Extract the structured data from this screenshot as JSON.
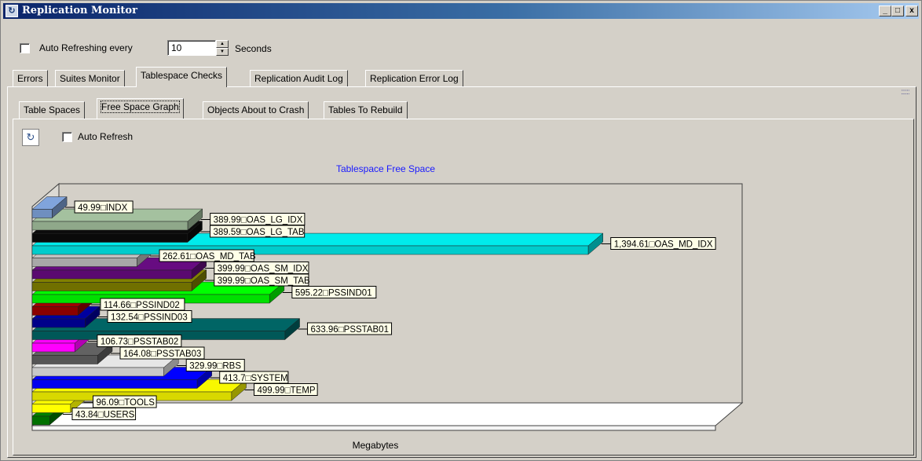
{
  "window": {
    "title": "Replication Monitor",
    "app_icon": "refresh-icon",
    "controls": [
      "_",
      "□",
      "x"
    ]
  },
  "auto_refresh_bar": {
    "checkbox_label": "Auto Refreshing every",
    "checked": false,
    "interval_value": "10",
    "unit_label": "Seconds"
  },
  "main_tabs": [
    {
      "label": "Errors"
    },
    {
      "label": "Suites Monitor"
    },
    {
      "label": "Tablespace Checks",
      "selected": true
    },
    {
      "label": "Replication Audit Log"
    },
    {
      "label": "Replication Error Log"
    }
  ],
  "sub_tabs": [
    {
      "label": "Table Spaces"
    },
    {
      "label": "Free Space Graph",
      "selected": true
    },
    {
      "label": "Objects About to Crash"
    },
    {
      "label": "Tables To Rebuild"
    }
  ],
  "graph_toolbar": {
    "refresh_icon": "refresh-icon",
    "auto_refresh_label": "Auto Refresh",
    "auto_refresh_checked": false
  },
  "chart_data": {
    "type": "bar",
    "orientation": "horizontal",
    "style": "3d",
    "title": "Tablespace  Free Space",
    "xlabel": "Megabytes",
    "ylabel": "",
    "categories": [
      "INDX",
      "OAS_LG_IDX",
      "OAS_LG_TAB",
      "OAS_MD_IDX",
      "OAS_MD_TAB",
      "OAS_SM_IDX",
      "OAS_SM_TAB",
      "PSSIND01",
      "PSSIND02",
      "PSSIND03",
      "PSSTAB01",
      "PSSTAB02",
      "PSSTAB03",
      "RBS",
      "SYSTEM",
      "TEMP",
      "TOOLS",
      "USERS"
    ],
    "values": [
      49.99,
      389.99,
      389.59,
      1394.61,
      262.61,
      399.99,
      399.99,
      595.22,
      114.66,
      132.54,
      633.96,
      106.73,
      164.08,
      329.99,
      413.7,
      499.99,
      96.09,
      43.84
    ],
    "data_labels": [
      "49.99□INDX",
      "389.99□OAS_LG_IDX",
      "389.59□OAS_LG_TAB",
      "1,394.61□OAS_MD_IDX",
      "262.61□OAS_MD_TAB",
      "399.99□OAS_SM_IDX",
      "399.99□OAS_SM_TAB",
      "595.22□PSSIND01",
      "114.66□PSSIND02",
      "132.54□PSSIND03",
      "633.96□PSSTAB01",
      "106.73□PSSTAB02",
      "164.08□PSSTAB03",
      "329.99□RBS",
      "413.7□SYSTEM",
      "499.99□TEMP",
      "96.09□TOOLS",
      "43.84□USERS"
    ],
    "colors": [
      "#6f8fbf",
      "#8fa88a",
      "#0a0a0a",
      "#00cccc",
      "#a8a8a8",
      "#5a0a70",
      "#707000",
      "#00e000",
      "#8a0000",
      "#00008a",
      "#005858",
      "#ff00ff",
      "#555555",
      "#c8c8c8",
      "#0000ee",
      "#d8d800",
      "#ffff00",
      "#007000"
    ],
    "grid": false,
    "legend": "none"
  }
}
